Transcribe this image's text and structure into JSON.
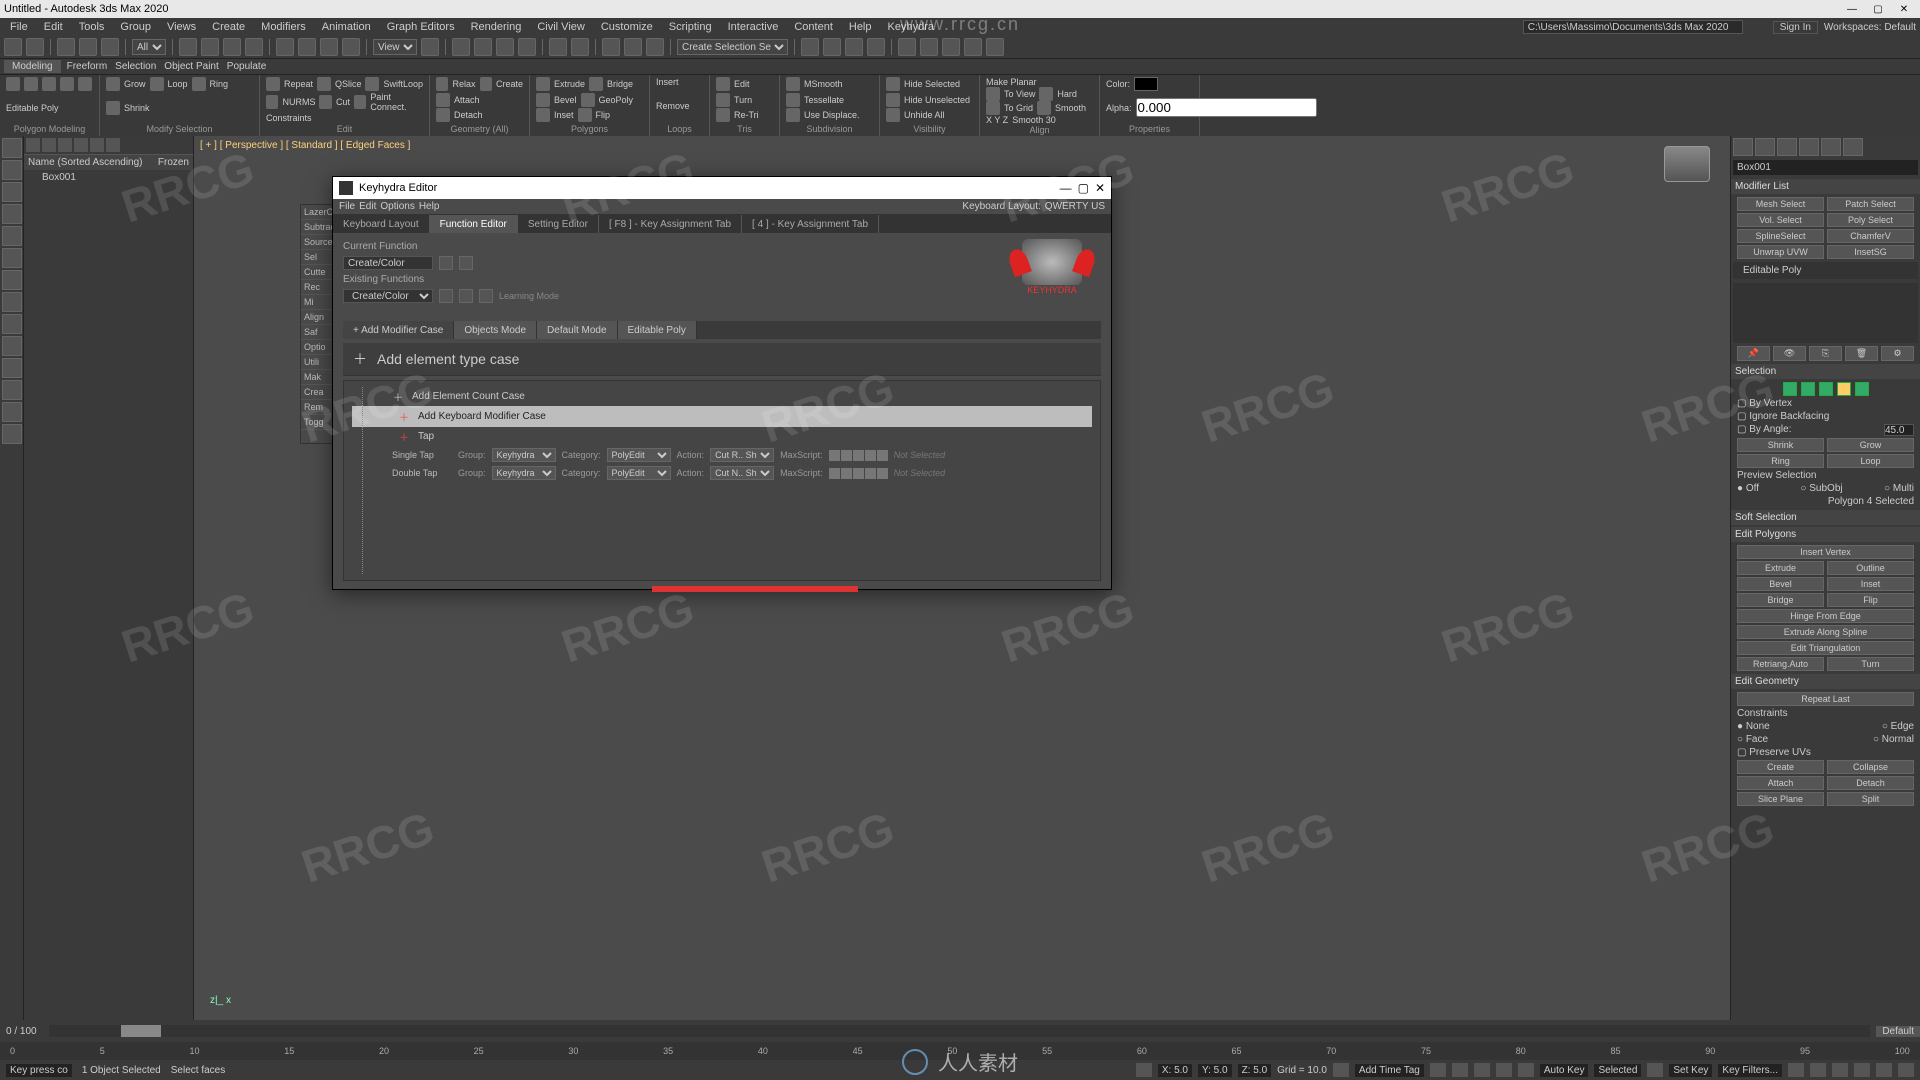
{
  "app_title": "Untitled - Autodesk 3ds Max 2020",
  "watermark_url": "www.rrcg.cn",
  "watermark_text": "RRCG",
  "watermark_footer": "人人素材",
  "menu": [
    "File",
    "Edit",
    "Tools",
    "Group",
    "Views",
    "Create",
    "Modifiers",
    "Animation",
    "Graph Editors",
    "Rendering",
    "Civil View",
    "Customize",
    "Scripting",
    "Interactive",
    "Content",
    "Help",
    "Keyhydra"
  ],
  "toprt_path": "C:\\Users\\Massimo\\Documents\\3ds Max 2020",
  "signin": "Sign In",
  "workspaces_label": "Workspaces: Default",
  "quick": {
    "selection_set": "Create Selection Se"
  },
  "ribbon": {
    "mode_tabs": [
      "Modeling",
      "Freeform",
      "Selection",
      "Object Paint",
      "Populate"
    ],
    "editable_poly": "Editable Poly",
    "poly_modeling": "Polygon Modeling",
    "modify_selection": "Modify Selection",
    "edit": "Edit",
    "geometry_all": "Geometry (All)",
    "polygons": "Polygons",
    "loops": "Loops",
    "tris": "Tris",
    "subdivision": "Subdivision",
    "visibility": "Visibility",
    "align": "Align",
    "properties": "Properties",
    "grow": "Grow",
    "shrink": "Shrink",
    "loop": "Loop",
    "ring": "Ring",
    "repeat": "Repeat",
    "nurms": "NURMS",
    "constraints": "Constraints",
    "qslice": "QSlice",
    "cut": "Cut",
    "swiftloop": "SwiftLoop",
    "paintconnect": "Paint Connect.",
    "relax": "Relax",
    "create": "Create",
    "attach": "Attach",
    "detach": "Detach",
    "extrude": "Extrude",
    "bevel": "Bevel",
    "inset": "Inset",
    "bridge": "Bridge",
    "geopoly": "GeoPoly",
    "flip": "Flip",
    "insert": "Insert",
    "remove": "Remove",
    "edit_btn": "Edit",
    "reti": "Re-Tri",
    "turn": "Turn",
    "msmooth": "MSmooth",
    "tessellate": "Tessellate",
    "usedispl": "Use Displace.",
    "hidesel": "Hide Selected",
    "hideunsel": "Hide Unselected",
    "unhideall": "Unhide All",
    "makeplanar": "Make Planar",
    "toview": "To View",
    "togrid": "To Grid",
    "xyz": "X   Y   Z",
    "hard": "Hard",
    "smooth": "Smooth",
    "smooth30": "Smooth 30",
    "color": "Color:",
    "alpha": "Alpha:",
    "alpha_val": "0.000"
  },
  "scene": {
    "toolbar_btns": 8,
    "header_name": "Name (Sorted Ascending)",
    "header_frozen": "Frozen",
    "item": "Box001"
  },
  "viewport_label": "[ + ] [ Perspective ] [ Standard ] [ Edged Faces ]",
  "leftslice": [
    "LazerCut",
    "Subtract",
    "Source",
    "Sel",
    "Cutte",
    "Rec",
    "Mi",
    "Align",
    "Saf",
    "Optio",
    "Utili",
    "Mak",
    "Crea",
    "Rem",
    "Togg"
  ],
  "dialog": {
    "title": "Keyhydra Editor",
    "menu": [
      "File",
      "Edit",
      "Options",
      "Help"
    ],
    "tabs": [
      "Keyboard Layout",
      "Function Editor",
      "Setting Editor",
      "[ F8 ] - Key Assignment Tab",
      "[ 4 ] - Key Assignment Tab"
    ],
    "active_tab": 1,
    "kb_layout_label": "Keyboard Layout:",
    "kb_layout_val": "QWERTY US",
    "current_function": "Current Function",
    "current_val": "Create/Color",
    "existing": "Existing Functions",
    "existing_val": "Create/Color",
    "learning": "Learning Mode",
    "logo": "KEYHYDRA",
    "case_tabs": [
      "+ Add Modifier Case",
      "Objects Mode",
      "Default Mode",
      "Editable Poly"
    ],
    "add_element_case": "Add element type case",
    "row_count": "Add Element Count Case",
    "row_kbmod": "Add Keyboard Modifier Case",
    "row_tap": "Tap",
    "tap1": "Single Tap",
    "tap2": "Double Tap",
    "grp": "Group:",
    "grp_val": "Keyhydra",
    "cat": "Category:",
    "cat_val": "PolyEdit",
    "act": "Action:",
    "act1": "Cut R.. Shape",
    "act2": "Cut N.. Shape",
    "max": "MaxScript:",
    "notsel": "Not Selected"
  },
  "cmd": {
    "obj": "Box001",
    "modlist": "Modifier List",
    "mods": [
      [
        "Mesh Select",
        "Patch Select"
      ],
      [
        "Vol. Select",
        "Poly Select"
      ],
      [
        "SplineSelect",
        "ChamferV"
      ],
      [
        "Unwrap UVW",
        "InsetSG"
      ]
    ],
    "stack": "Editable Poly",
    "selection": "Selection",
    "byvertex": "By Vertex",
    "ignoreback": "Ignore Backfacing",
    "byangle": "By Angle:",
    "angle": "45.0",
    "shrink": "Shrink",
    "grow": "Grow",
    "ring": "Ring",
    "loop": "Loop",
    "previewsel": "Preview Selection",
    "off": "Off",
    "subobj": "SubObj",
    "multi": "Multi",
    "polysel": "Polygon 4 Selected",
    "softsel": "Soft Selection",
    "editpolys": "Edit Polygons",
    "insertv": "Insert Vertex",
    "extrude": "Extrude",
    "outline": "Outline",
    "bevel": "Bevel",
    "inset": "Inset",
    "bridge": "Bridge",
    "flip": "Flip",
    "hinge": "Hinge From Edge",
    "extralong": "Extrude Along Spline",
    "edittri": "Edit Triangulation",
    "retriauto": "Retriang.Auto",
    "turn": "Turn",
    "editgeo": "Edit Geometry",
    "repeatlast": "Repeat Last",
    "constraints": "Constraints",
    "none": "None",
    "edge": "Edge",
    "face": "Face",
    "normal": "Normal",
    "preserveuv": "Preserve UVs",
    "createb": "Create",
    "collapse": "Collapse",
    "attach": "Attach",
    "detach": "Detach",
    "sliceplane": "Slice Plane",
    "split": "Split"
  },
  "time": {
    "range": "0 / 100",
    "default": "Default"
  },
  "track_ticks": [
    "0",
    "5",
    "10",
    "15",
    "20",
    "25",
    "30",
    "35",
    "40",
    "45",
    "50",
    "55",
    "60",
    "65",
    "70",
    "75",
    "80",
    "85",
    "90",
    "95",
    "100"
  ],
  "status": {
    "sel": "1 Object Selected",
    "keypress": "Key press co",
    "faces": "Select faces",
    "x": "X: 5.0",
    "y": "Y: 5.0",
    "z": "Z: 5.0",
    "grid": "Grid = 10.0",
    "autokey": "Auto Key",
    "selectedk": "Selected",
    "settkey": "Set Key",
    "keyfilters": "Key Filters...",
    "addtag": "Add Time Tag"
  }
}
